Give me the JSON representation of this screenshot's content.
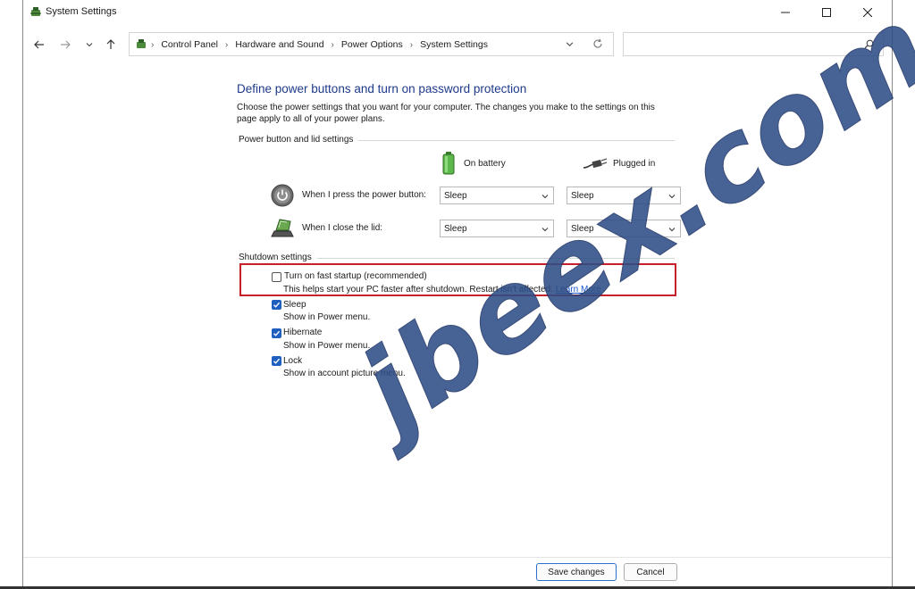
{
  "window": {
    "title": "System Settings"
  },
  "address_bar": {
    "crumbs": [
      "Control Panel",
      "Hardware and Sound",
      "Power Options",
      "System Settings"
    ],
    "search_placeholder": ""
  },
  "page": {
    "heading": "Define power buttons and turn on password protection",
    "intro": "Choose the power settings that you want for your computer. The changes you make to the settings on this page apply to all of your power plans."
  },
  "power_group": {
    "label": "Power button and lid settings",
    "col_battery": "On battery",
    "col_plugged": "Plugged in",
    "rows": [
      {
        "label": "When I press the power button:",
        "battery": "Sleep",
        "plugged": "Sleep"
      },
      {
        "label": "When I close the lid:",
        "battery": "Sleep",
        "plugged": "Sleep"
      }
    ]
  },
  "shutdown_group": {
    "label": "Shutdown settings",
    "options": [
      {
        "label": "Turn on fast startup (recommended)",
        "checked": false,
        "desc": "This helps start your PC faster after shutdown. Restart isn't affected.",
        "link": "Learn More"
      },
      {
        "label": "Sleep",
        "checked": true,
        "desc": "Show in Power menu."
      },
      {
        "label": "Hibernate",
        "checked": true,
        "desc": "Show in Power menu."
      },
      {
        "label": "Lock",
        "checked": true,
        "desc": "Show in account picture menu."
      }
    ]
  },
  "footer": {
    "save_label": "Save changes",
    "cancel_label": "Cancel"
  },
  "watermark": "jbeex.com",
  "colors": {
    "heading": "#1e3a8a",
    "checkbox": "#1f5fbf",
    "highlight": "#c8202a",
    "watermark": "#2e4d86"
  }
}
